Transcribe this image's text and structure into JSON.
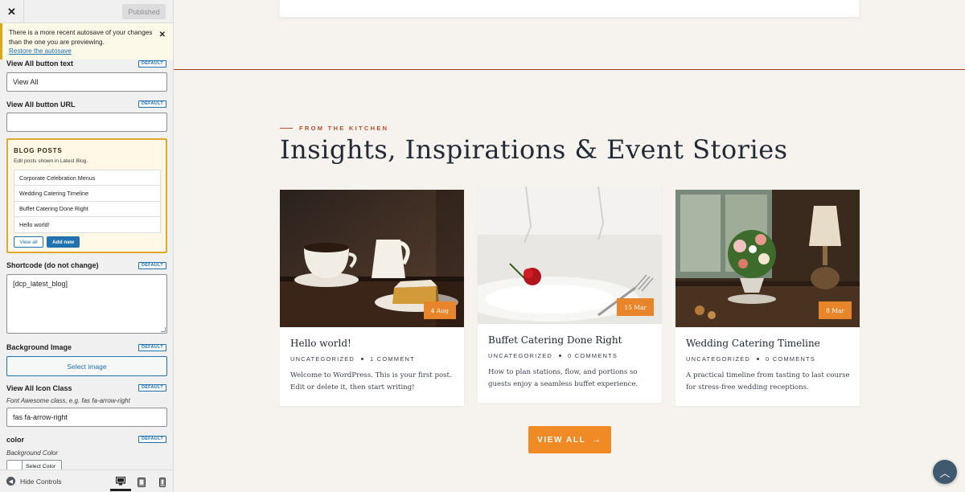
{
  "topbar": {
    "close_icon": "close-icon",
    "publish_label": "Published"
  },
  "notice": {
    "text": "There is a more recent autosave of your changes than the one you are previewing.",
    "link": "Restore the autosave"
  },
  "default_badge": "DEFAULT",
  "controls": {
    "view_all_text": {
      "label": "View All button text",
      "value": "View All"
    },
    "view_all_url": {
      "label": "View All button URL",
      "value": ""
    },
    "blog_posts": {
      "title": "BLOG POSTS",
      "subtitle": "Edit posts shown in Latest Blog.",
      "posts": [
        "Corporate Celebration Menus",
        "Wedding Catering Timeline",
        "Buffet Catering Done Right",
        "Hello world!"
      ],
      "view_all": "View all",
      "add_new": "Add new"
    },
    "shortcode": {
      "label": "Shortcode (do not change)",
      "value": "[dcp_latest_blog]"
    },
    "background_image": {
      "label": "Background Image",
      "button": "Select image"
    },
    "icon_class": {
      "label": "View All Icon Class",
      "hint": "Font Awesome class, e.g. fas fa-arrow-right",
      "value": "fas fa-arrow-right"
    },
    "color": {
      "label": "color",
      "sub_label": "Background Color",
      "button": "Select Color"
    }
  },
  "footer": {
    "hide_controls": "Hide Controls",
    "devices": [
      "desktop-icon",
      "tablet-icon",
      "mobile-icon"
    ]
  },
  "preview": {
    "eyebrow": "FROM THE KITCHEN",
    "heading": "Insights, Inspirations & Event Stories",
    "cards": [
      {
        "title": "Hello world!",
        "date": "4 Aug",
        "category": "UNCATEGORIZED",
        "comments": "1 COMMENT",
        "excerpt": "Welcome to WordPress. This is your first post. Edit or delete it, then start writing!"
      },
      {
        "title": "Buffet Catering Done Right",
        "date": "15 Mar",
        "category": "UNCATEGORIZED",
        "comments": "0 COMMENTS",
        "excerpt": "How to plan stations, flow, and portions so guests enjoy a seamless buffet experience."
      },
      {
        "title": "Wedding Catering Timeline",
        "date": "8 Mar",
        "category": "UNCATEGORIZED",
        "comments": "0 COMMENTS",
        "excerpt": "A practical timeline from tasting to last course for stress-free wedding receptions."
      }
    ],
    "view_all_button": "VIEW ALL",
    "accent_color": "#f08a24",
    "heading_color": "#222a35"
  }
}
